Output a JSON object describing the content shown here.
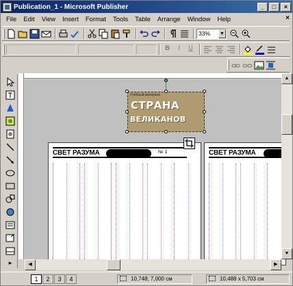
{
  "window": {
    "title": "Publication_1 - Microsoft Publisher"
  },
  "menu": {
    "items": [
      "File",
      "Edit",
      "View",
      "Insert",
      "Format",
      "Tools",
      "Table",
      "Arrange",
      "Window",
      "Help"
    ]
  },
  "toolbar": {
    "zoom_value": "33%"
  },
  "document": {
    "logo_line1": "СТРАНА",
    "logo_line2": "ВЕЛИКАНОВ",
    "logo_caption": "Учебный материал",
    "page_left_masthead": "СВЕТ РАЗУМА",
    "page_left_issue": "№ 1",
    "page_right_masthead": "СВЕТ РАЗУМА"
  },
  "status": {
    "pages": [
      "1",
      "2",
      "3",
      "4"
    ],
    "active_page": "1",
    "position": "10,748; 7,000 см",
    "size": "10,488 x 5,703 см"
  },
  "colors": {
    "title_start": "#0a246a",
    "title_end": "#3a6ea5",
    "guide_purple": "#b060c0"
  }
}
